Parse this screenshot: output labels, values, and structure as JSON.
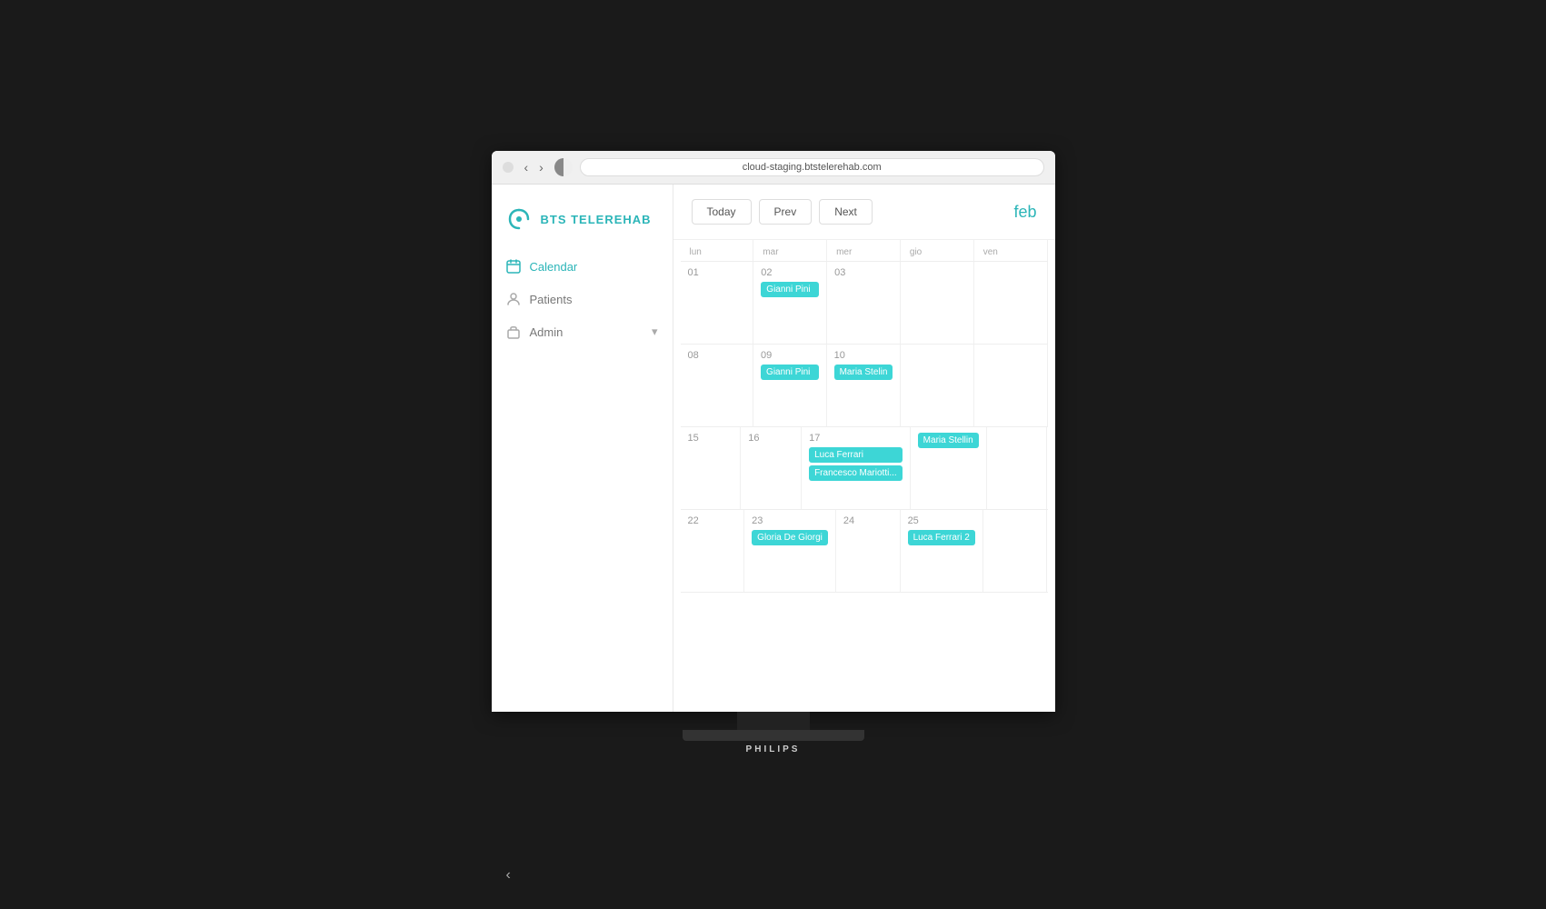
{
  "browser": {
    "url": "cloud-staging.btstelerehab.com"
  },
  "app": {
    "logo_text": "BTS TELEREHAB"
  },
  "sidebar": {
    "items": [
      {
        "id": "calendar",
        "label": "Calendar",
        "active": true
      },
      {
        "id": "patients",
        "label": "Patients",
        "active": false
      },
      {
        "id": "admin",
        "label": "Admin",
        "active": false
      }
    ]
  },
  "calendar": {
    "title": "feb",
    "buttons": {
      "today": "Today",
      "prev": "Prev",
      "next": "Next"
    },
    "day_headers": [
      "lun",
      "mar",
      "mer",
      "gio",
      "ven"
    ],
    "weeks": [
      {
        "days": [
          {
            "number": "01",
            "events": []
          },
          {
            "number": "02",
            "events": [
              "Gianni Pini"
            ]
          },
          {
            "number": "03",
            "events": []
          },
          {
            "number": "",
            "events": []
          },
          {
            "number": "",
            "events": []
          }
        ]
      },
      {
        "days": [
          {
            "number": "08",
            "events": []
          },
          {
            "number": "09",
            "events": [
              "Gianni Pini"
            ]
          },
          {
            "number": "10",
            "events": [
              "Maria Stelin"
            ]
          },
          {
            "number": "",
            "events": []
          },
          {
            "number": "",
            "events": []
          }
        ]
      },
      {
        "days": [
          {
            "number": "15",
            "events": []
          },
          {
            "number": "16",
            "events": []
          },
          {
            "number": "17",
            "events": [
              "Luca Ferrari",
              "Francesco Mariotti..."
            ]
          },
          {
            "number": "",
            "events": [
              "Maria Stellin"
            ]
          },
          {
            "number": "",
            "events": []
          }
        ]
      },
      {
        "days": [
          {
            "number": "22",
            "events": []
          },
          {
            "number": "23",
            "events": [
              "Gloria De Giorgi"
            ]
          },
          {
            "number": "24",
            "events": []
          },
          {
            "number": "25",
            "events": [
              "Luca Ferrari 2"
            ]
          },
          {
            "number": "",
            "events": []
          }
        ]
      }
    ]
  },
  "monitor": {
    "brand": "PHILIPS"
  }
}
